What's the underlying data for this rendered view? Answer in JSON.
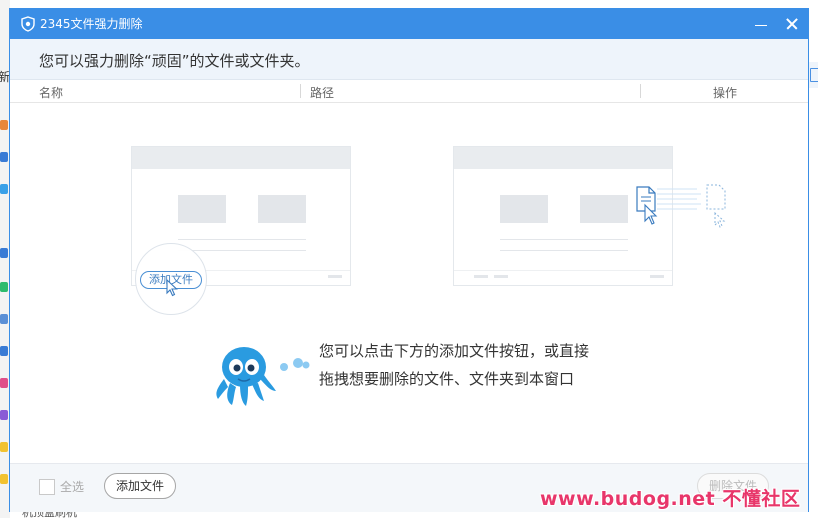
{
  "window": {
    "title": "2345文件强力删除"
  },
  "subtitle": "您可以强力删除“顽固”的文件或文件夹。",
  "columns": {
    "name": "名称",
    "path": "路径",
    "action": "操作"
  },
  "illustration": {
    "add_label": "添加文件"
  },
  "hint": {
    "line1": "您可以点击下方的添加文件按钮，或直接",
    "line2": "拖拽想要删除的文件、文件夹到本窗口"
  },
  "footer": {
    "select_all": "全选",
    "add_button": "添加文件",
    "delete_button": "删除文件"
  },
  "background": {
    "left_text": "新",
    "bottom_text": "机顶盒刷机"
  },
  "watermark": "www.budog.net 不懂社区",
  "colors": {
    "accent": "#3a8ee6",
    "subtitle_bg": "#eef4fb",
    "mascot": "#2a9be0",
    "watermark": "#e8366a"
  }
}
